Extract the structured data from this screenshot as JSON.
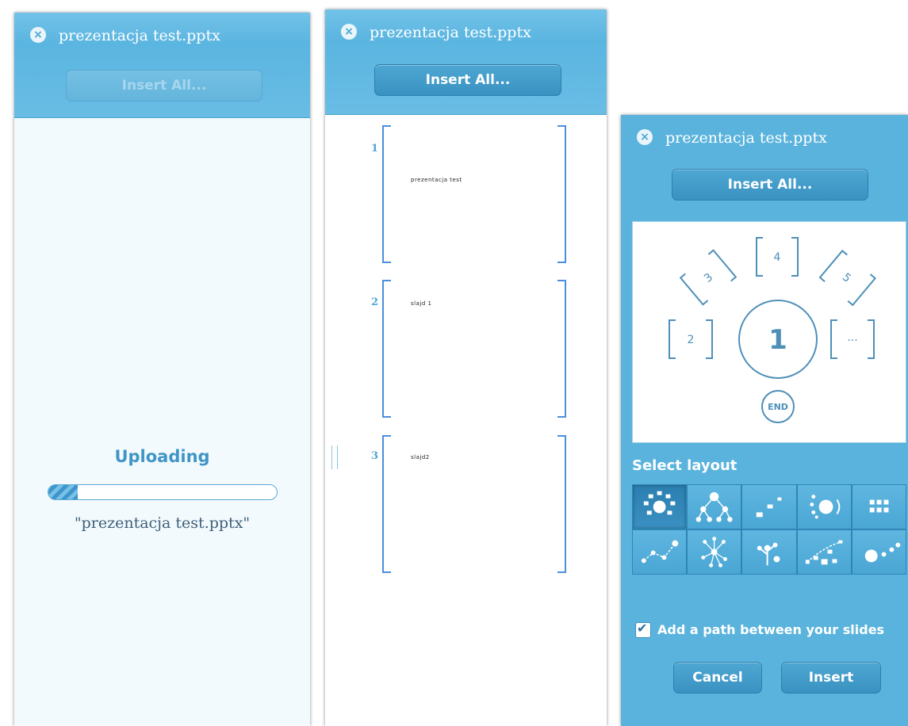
{
  "colors": {
    "accent": "#5ab5e0",
    "button": "#3a92c2",
    "slide_bracket": "#4a8fdc"
  },
  "panels": [
    {
      "title": "prezentacja test.pptx",
      "close_icon": "close-icon",
      "insert_all_label": "Insert All...",
      "insert_all_state": "disabled",
      "status_label": "Uploading",
      "progress": 0.13,
      "filename": "\"prezentacja test.pptx\""
    },
    {
      "title": "prezentacja test.pptx",
      "close_icon": "close-icon",
      "insert_all_label": "Insert All...",
      "slides": [
        {
          "number": "1",
          "text": "prezentacja test"
        },
        {
          "number": "2",
          "text": "slajd 1"
        },
        {
          "number": "3",
          "text": "slajd2"
        }
      ]
    },
    {
      "title": "prezentacja test.pptx",
      "close_icon": "close-icon",
      "insert_all_label": "Insert All...",
      "preview": {
        "center": "1",
        "nodes": [
          "2",
          "3",
          "4",
          "5",
          "...",
          "END"
        ]
      },
      "select_layout_label": "Select layout",
      "layouts": [
        "circle-layout-icon",
        "tree-layout-icon",
        "steps-layout-icon",
        "orbit-layout-icon",
        "grid-layout-icon",
        "path-layout-icon",
        "star-layout-icon",
        "branch-layout-icon",
        "arc-layout-icon",
        "line-layout-icon"
      ],
      "selected_layout": 0,
      "path_checkbox_checked": true,
      "path_checkbox_label": "Add a path between your slides",
      "cancel_label": "Cancel",
      "insert_label": "Insert"
    }
  ]
}
